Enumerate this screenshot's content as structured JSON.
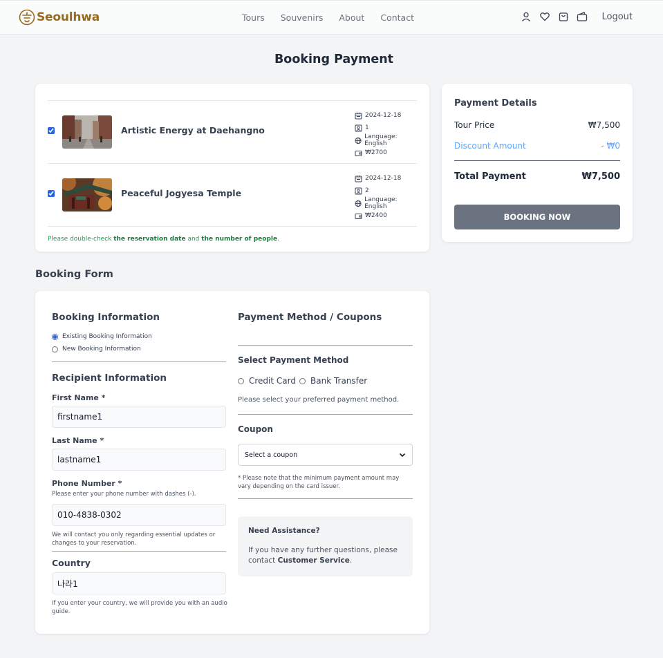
{
  "header": {
    "brand": "Seoulhwa",
    "nav": [
      "Tours",
      "Souvenirs",
      "About",
      "Contact"
    ],
    "logout_label": "Logout"
  },
  "page_title": "Booking Payment",
  "cart": {
    "items": [
      {
        "name": "Artistic Energy at Daehangno",
        "checked": true,
        "date": "2024-12-18",
        "people": "1",
        "language": "Language: English",
        "price": "₩2700"
      },
      {
        "name": "Peaceful Jogyesa Temple",
        "checked": true,
        "date": "2024-12-18",
        "people": "2",
        "language": "Language: English",
        "price": "₩2400"
      }
    ],
    "notice_prefix": "Please double-check ",
    "notice_bold1": "the reservation date",
    "notice_mid": " and ",
    "notice_bold2": "the number of people",
    "notice_suffix": "."
  },
  "payment_details": {
    "title": "Payment Details",
    "tour_price_label": "Tour Price",
    "tour_price_value": "₩7,500",
    "discount_label": "Discount Amount",
    "discount_value": "- ₩0",
    "total_label": "Total Payment",
    "total_value": "₩7,500",
    "book_button": "BOOKING NOW"
  },
  "booking_form": {
    "section_title": "Booking Form",
    "booking_info_title": "Booking Information",
    "existing_option": "Existing Booking Information",
    "new_option": "New Booking Information",
    "recipient_title": "Recipient Information",
    "first_name_label": "First Name *",
    "first_name_value": "firstname1",
    "last_name_label": "Last Name *",
    "last_name_value": "lastname1",
    "phone_label": "Phone Number *",
    "phone_hint": "Please enter your phone number with dashes (-).",
    "phone_value": "010-4838-0302",
    "contact_note": "We will contact you only regarding essential updates or changes to your reservation.",
    "country_label": "Country",
    "country_value": "나라1",
    "country_note": "If you enter your country, we will provide you with an audio guide."
  },
  "payment_method": {
    "title": "Payment Method / Coupons",
    "select_title": "Select Payment Method",
    "options": [
      "Credit Card",
      "Bank Transfer"
    ],
    "hint": "Please select your preferred payment method.",
    "coupon_title": "Coupon",
    "coupon_placeholder": "Select a coupon",
    "coupon_note": "* Please note that the minimum payment amount may vary depending on the card issuer."
  },
  "assistance": {
    "title": "Need Assistance?",
    "text_prefix": "If you have any further questions, please contact ",
    "link": "Customer Service",
    "text_suffix": "."
  },
  "colors": {
    "brand": "#9a6b1f",
    "notice_green": "#16a34a",
    "discount_blue": "#60a5fa",
    "button_gray": "#6b7280"
  }
}
